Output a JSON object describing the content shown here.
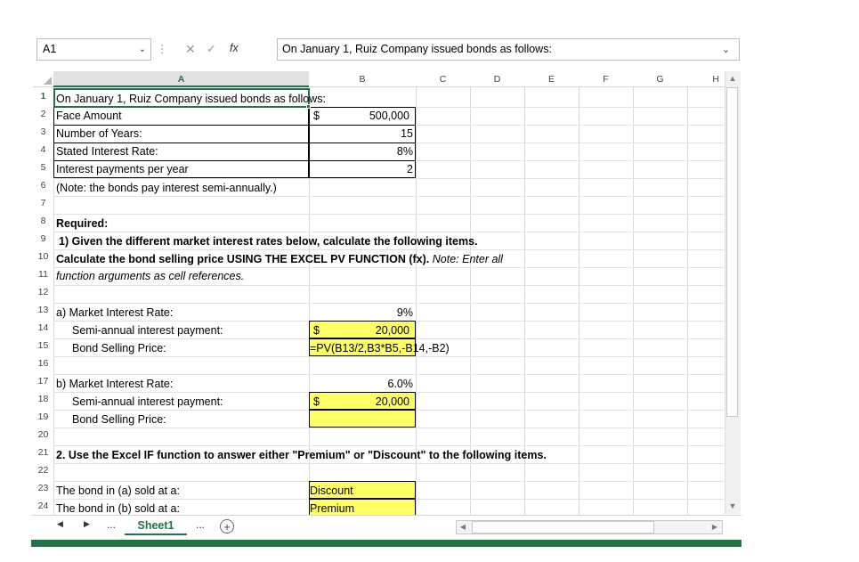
{
  "name_box": "A1",
  "formula_bar": "On January 1,  Ruiz Company issued bonds as follows:",
  "fx_label": "fx",
  "columns": [
    "A",
    "B",
    "C",
    "D",
    "E",
    "F",
    "G",
    "H"
  ],
  "rows": [
    "1",
    "2",
    "3",
    "4",
    "5",
    "6",
    "7",
    "8",
    "9",
    "10",
    "11",
    "12",
    "13",
    "14",
    "15",
    "16",
    "17",
    "18",
    "19",
    "20",
    "21",
    "22",
    "23",
    "24"
  ],
  "cells": {
    "a1": "On January 1,  Ruiz Company issued bonds as follows:",
    "a2": "Face Amount",
    "b2_sym": "$",
    "b2": "500,000",
    "a3": "Number of Years:",
    "b3": "15",
    "a4": "Stated Interest Rate:",
    "b4": "8%",
    "a5": "Interest payments per year",
    "b5": "2",
    "a6": "(Note: the bonds pay interest semi-annually.)",
    "a8": "Required:",
    "a9": "1) Given the different market interest rates below, calculate the following items.",
    "a10_bold": "Calculate the bond selling price USING THE EXCEL PV FUNCTION (fx).",
    "a10_ital": " Note: Enter all",
    "a11": "function arguments as cell references.",
    "a13": "a) Market Interest Rate:",
    "b13": "9%",
    "a14": "Semi-annual interest payment:",
    "b14_sym": "$",
    "b14": "20,000",
    "a15": "Bond Selling Price:",
    "b15": "=PV(B13/2,B3*B5,-B14,-B2)",
    "a17": "b) Market Interest Rate:",
    "b17": "6.0%",
    "a18": "Semi-annual interest payment:",
    "b18_sym": "$",
    "b18": "20,000",
    "a19": "Bond Selling Price:",
    "a21": "2. Use the Excel IF function to answer either \"Premium\" or \"Discount\" to the following items.",
    "a23": "The bond in (a) sold at a:",
    "b23": "Discount",
    "a24": "The bond in (b) sold at a:",
    "b24": "Premium"
  },
  "sheet_tab": "Sheet1",
  "tab_more_left": "...",
  "tab_more_right": "...",
  "colors": {
    "accent": "#217346",
    "highlight": "#ffff66"
  }
}
